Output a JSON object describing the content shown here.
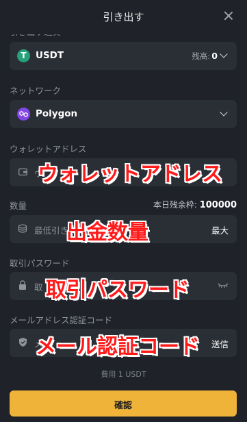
{
  "header": {
    "title": "引き出す"
  },
  "sections": {
    "coin_label": "引き出す通貨",
    "network_label": "ネットワーク",
    "address_label": "ウォレットアドレス",
    "amount_label": "数量",
    "password_label": "取引パスワード",
    "email_label": "メールアドレス認証コード"
  },
  "coin": {
    "name": "USDT",
    "balance_label": "残高:",
    "balance_value": "0",
    "icon": "tether-icon"
  },
  "network": {
    "name": "Polygon",
    "icon": "polygon-icon"
  },
  "address": {
    "placeholder_visible": "ウ",
    "icon": "wallet-icon"
  },
  "amount": {
    "limit_label": "本日残余枠:",
    "limit_value": "100000",
    "placeholder_visible": "最低引き",
    "max_label": "最大",
    "icon": "coins-icon"
  },
  "password": {
    "placeholder_visible": "取",
    "icon": "lock-icon",
    "toggle_icon": "eye-closed-icon"
  },
  "email_code": {
    "placeholder_visible": "メ",
    "send_label": "送信",
    "icon": "shield-check-icon"
  },
  "overlays": {
    "address": "ウォレットアドレス",
    "amount": "出金数量",
    "password": "取引パスワード",
    "email": "メール認証コード"
  },
  "fee": "費用 1 USDT",
  "confirm_label": "確認",
  "colors": {
    "accent": "#f0b33a",
    "overlay_text": "#ff1a1a",
    "usdt": "#26a17b",
    "polygon": "#8247e5"
  }
}
